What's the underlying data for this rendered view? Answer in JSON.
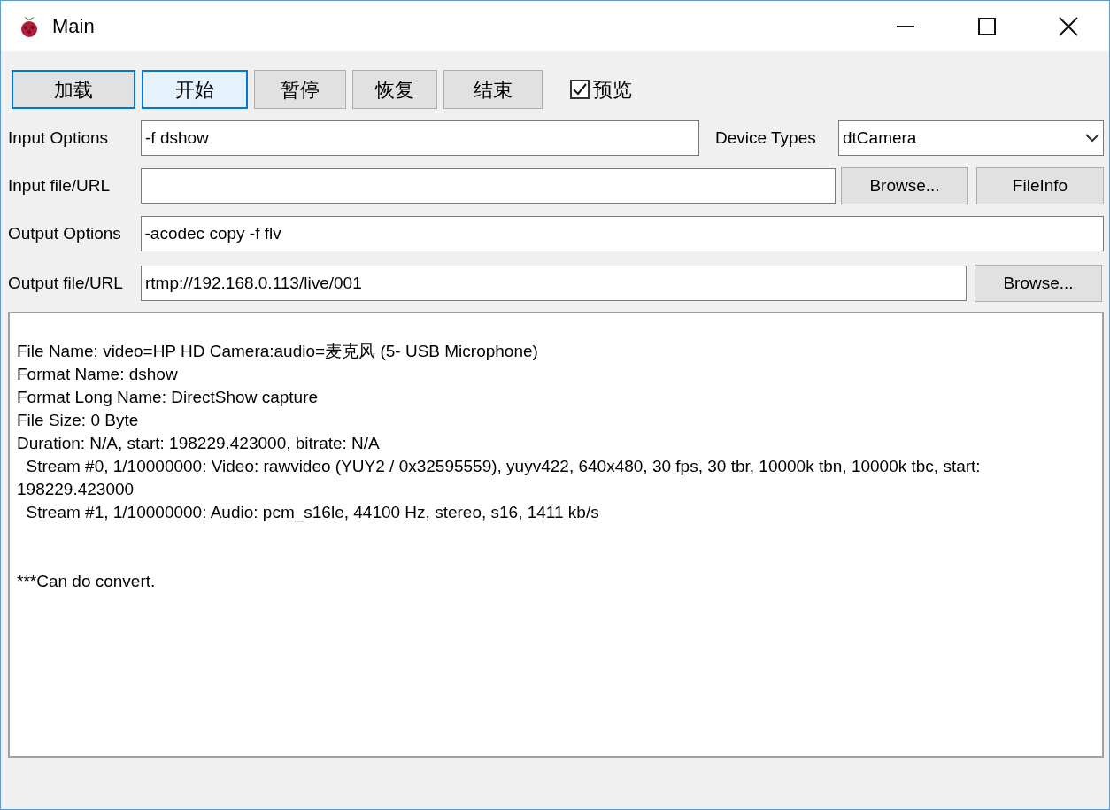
{
  "window": {
    "title": "Main"
  },
  "toolbar": {
    "buttons": [
      {
        "label": "加载",
        "focused": true,
        "hovered": false
      },
      {
        "label": "开始",
        "focused": false,
        "hovered": true
      },
      {
        "label": "暂停",
        "focused": false,
        "hovered": false
      },
      {
        "label": "恢复",
        "focused": false,
        "hovered": false
      },
      {
        "label": "结束",
        "focused": false,
        "hovered": false
      }
    ],
    "preview": {
      "label": "预览",
      "checked": true
    }
  },
  "input_options": {
    "label": "Input Options",
    "value": "-f dshow"
  },
  "device_types": {
    "label": "Device Types",
    "value": "dtCamera"
  },
  "input_file": {
    "label": "Input file/URL",
    "buttons": [
      "Browse...",
      "FileInfo"
    ]
  },
  "output_options": {
    "label": "Output Options",
    "value": "-acodec copy -f flv"
  },
  "output_file": {
    "label": "Output file/URL",
    "value": "rtmp://192.168.0.113/live/001",
    "buttons": [
      "Browse..."
    ]
  },
  "log": {
    "lines": [
      {
        "kind": "info",
        "text": "File Name: video=HP HD Camera:audio=麦克风 (5- USB Microphone)"
      },
      {
        "kind": "info",
        "text": "Format Name: dshow"
      },
      {
        "kind": "info",
        "text": "Format Long Name: DirectShow capture"
      },
      {
        "kind": "info",
        "text": "File Size: 0 Byte"
      },
      {
        "kind": "info",
        "text": "Duration: N/A, start: 198229.423000, bitrate: N/A"
      },
      {
        "kind": "info",
        "text": "  Stream #0, 1/10000000: Video: rawvideo (YUY2 / 0x32595559), yuyv422, 640x480, 30 fps, 30 tbr, 10000k tbn, 10000k tbc, start: 198229.423000"
      },
      {
        "kind": "info",
        "text": "  Stream #1, 1/10000000: Audio: pcm_s16le, 44100 Hz, stereo, s16, 1411 kb/s"
      },
      {
        "kind": "result",
        "text": "***Can do convert."
      }
    ]
  }
}
